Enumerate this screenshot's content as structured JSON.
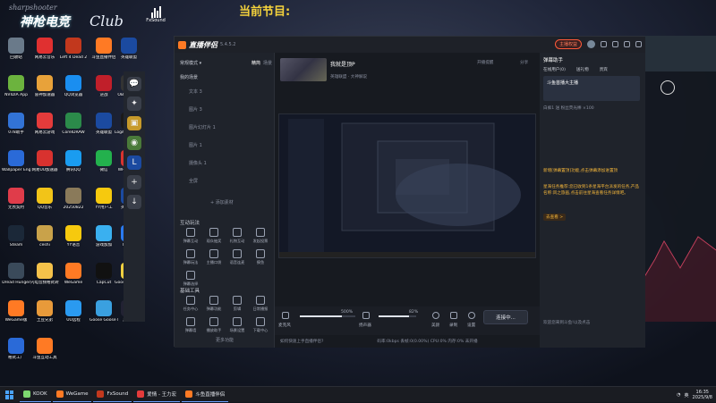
{
  "overlay": {
    "program_label": "当前节目:"
  },
  "logo": {
    "line1": "sharpshooter",
    "line2": "神枪电竞",
    "line3": "Club"
  },
  "fxsound": {
    "label": "FxSound"
  },
  "desktop_icons": [
    {
      "label": "回收站",
      "color": "#6a7a8a"
    },
    {
      "label": "网易云音乐",
      "color": "#e03030"
    },
    {
      "label": "Left 4 Dead 2",
      "color": "#c2381d"
    },
    {
      "label": "斗鱼直播伴侣",
      "color": "#ff7a24"
    },
    {
      "label": "英雄联盟",
      "color": "#1b4aa0"
    },
    {
      "label": "NVIDIA App",
      "color": "#6cb33e"
    },
    {
      "label": "雷神加速器",
      "color": "#e8a23a"
    },
    {
      "label": "QQ浏览器",
      "color": "#1a8ef0"
    },
    {
      "label": "逆战",
      "color": "#c01f2a"
    },
    {
      "label": "OBS Studio",
      "color": "#333"
    },
    {
      "label": "078助手",
      "color": "#3273d6"
    },
    {
      "label": "网易云游戏",
      "color": "#e43b3b"
    },
    {
      "label": "CorelDRAW",
      "color": "#2b8a4a"
    },
    {
      "label": "英雄联盟",
      "color": "#1b4aa0"
    },
    {
      "label": "Logitech G HUB",
      "color": "#1a1a1a"
    },
    {
      "label": "Wallpaper Engine",
      "color": "#2a6ad8"
    },
    {
      "label": "网易UU加速器",
      "color": "#d8322f"
    },
    {
      "label": "腾讯QQ",
      "color": "#1a9cf0"
    },
    {
      "label": "微信",
      "color": "#23b14d"
    },
    {
      "label": "WPS Office",
      "color": "#d8332f"
    },
    {
      "label": "无畏契约",
      "color": "#e03c4a"
    },
    {
      "label": "QQ音乐",
      "color": "#f2c418"
    },
    {
      "label": "20250822",
      "color": "#8a7a5a"
    },
    {
      "label": "YY用户工",
      "color": "#f6c90e"
    },
    {
      "label": "英雄联盟",
      "color": "#1b4aa0"
    },
    {
      "label": "Steam",
      "color": "#1b2838"
    },
    {
      "label": "ceshi",
      "color": "#c9a24a"
    },
    {
      "label": "YY语音",
      "color": "#f6c90e"
    },
    {
      "label": "游戏加加",
      "color": "#3ab0f0"
    },
    {
      "label": "ToDesk",
      "color": "#2a7af0"
    },
    {
      "label": "Dread Hunger",
      "color": "#3a4a5a"
    },
    {
      "label": "闪电音频格式转换器",
      "color": "#f5c24a"
    },
    {
      "label": "WeGame",
      "color": "#ff7a24"
    },
    {
      "label": "CapCut",
      "color": "#111"
    },
    {
      "label": "Goose Goose Duck",
      "color": "#f0d040"
    },
    {
      "label": "WeGame版",
      "color": "#ff7a24"
    },
    {
      "label": "土豆兄弟",
      "color": "#e89a3a"
    },
    {
      "label": "UU远程",
      "color": "#2a9af0"
    },
    {
      "label": "Goose Goose Duck",
      "color": "#3aa0e0"
    },
    {
      "label": "黑神话",
      "color": "#223"
    },
    {
      "label": "格式工厂",
      "color": "#2a6ad8"
    },
    {
      "label": "斗鱼互动工具",
      "color": "#ff7a24"
    }
  ],
  "window": {
    "brand": "直播伴侣",
    "version": "5.4.5.2",
    "streaming_pill": "主播权益",
    "left": {
      "mode": "常规模式",
      "tab_a": "精简",
      "tab_b": "场景",
      "scenes_label": "我的场景",
      "sources": [
        "文本 3",
        "图片 3",
        "图片幻灯片 1",
        "图片 1",
        "摄像头 1",
        "全屏"
      ],
      "add_source": "+ 添加素材",
      "interact_label": "互动玩法",
      "interact_tools": [
        "弹幕互动",
        "观众抽奖",
        "礼物互动",
        "发起投票",
        "弹幕玩法",
        "主播口袋",
        "语音连麦",
        "摸鱼",
        "弹幕选择"
      ],
      "basic_label": "基础工具",
      "basic_tools": [
        "任务中心",
        "弹幕功能",
        "剪辑",
        "日常播报",
        "弹幕墙",
        "播放助手",
        "场景设置",
        "下载中心"
      ],
      "more": "更多功能"
    },
    "center": {
      "stream_title": "我就是顶P",
      "stream_cat": "英雄联盟 · 大神解说",
      "open_live": "开播提醒",
      "share": "分享",
      "mic_label": "麦克风",
      "mic_vol": "500%",
      "sys_label": "扬声器",
      "sys_vol": "82%",
      "ctrl_a": "美颜",
      "ctrl_b": "录制",
      "ctrl_c": "设置",
      "start_btn": "连接中...",
      "status": "如何快速上手直播伴侣?",
      "status_stats": "码率:0kbps   丢帧:0(0.00%)   CPU:0%   内存:0%   未开播"
    },
    "right": {
      "helper": "弹幕助手",
      "tabs": [
        "在线用户(0)",
        "送礼物",
        "贵宾"
      ],
      "banner": "斗鱼首播大主播",
      "sponsor": "白痴1 送 粉丝荧光棒 ×100",
      "notice1": "新增[弹幕置顶]功能,点击弹幕添加进置顶",
      "notice2": "星海任务推荐:您已收到1条星海平台派发的任务,产品名称:风之旅画,点击前往星海查看任务详情吧。",
      "go": "去查看 >",
      "footer": "欢迎您来到斗鱼!以及点击"
    }
  },
  "taskbar": {
    "items": [
      {
        "label": "KOOK",
        "color": "#7dd870"
      },
      {
        "label": "WeGame",
        "color": "#ff7a24"
      },
      {
        "label": "FxSound",
        "color": "#c2381d"
      },
      {
        "label": "爱情 - 王力宏",
        "color": "#e43b3b"
      },
      {
        "label": "斗鱼直播伴侣",
        "color": "#ff7a24"
      }
    ],
    "time": "16:35",
    "date": "2025/9/8",
    "lang": "英"
  }
}
